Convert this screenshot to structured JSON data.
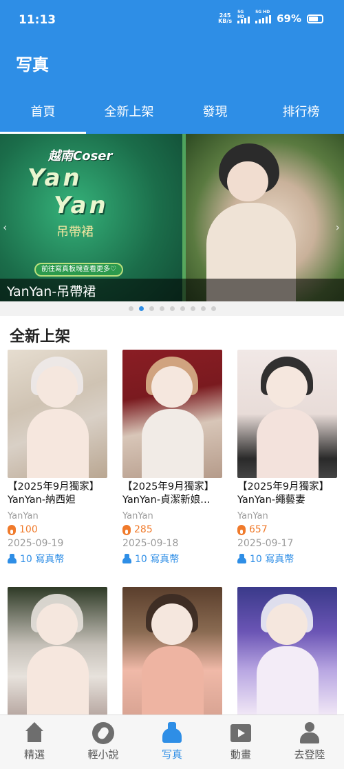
{
  "status_bar": {
    "time": "11:13",
    "net_speed": "245",
    "net_unit": "KB/s",
    "sig1_label": "5G HD",
    "sig2_label": "5G HD",
    "battery": "69%"
  },
  "header": {
    "title": "写真"
  },
  "tabs": [
    {
      "label": "首頁",
      "active": true
    },
    {
      "label": "全新上架",
      "active": false
    },
    {
      "label": "發現",
      "active": false
    },
    {
      "label": "排行榜",
      "active": false
    }
  ],
  "banner": {
    "promo_coser": "越南Coser",
    "promo_name_1": "Yan",
    "promo_name_2": "Yan",
    "promo_sub": "吊帶裙",
    "promo_cta": "前往寫真板塊查看更多♡",
    "caption": "YanYan-吊帶裙",
    "active_index": 1,
    "page_count": 9
  },
  "section": {
    "title": "全新上架",
    "items": [
      {
        "name": "【2025年9月獨家】YanYan-納西妲",
        "author": "YanYan",
        "heat": "100",
        "date": "2025-09-19",
        "price": "10 寫真幣"
      },
      {
        "name": "【2025年9月獨家】YanYan-貞潔新娘…",
        "author": "YanYan",
        "heat": "285",
        "date": "2025-09-18",
        "price": "10 寫真幣"
      },
      {
        "name": "【2025年9月獨家】YanYan-繩藝妻",
        "author": "YanYan",
        "heat": "657",
        "date": "2025-09-17",
        "price": "10 寫真幣"
      }
    ]
  },
  "bottom_nav": [
    {
      "label": "精選",
      "icon": "home-icon",
      "active": false
    },
    {
      "label": "輕小說",
      "icon": "compass-icon",
      "active": false
    },
    {
      "label": "写真",
      "icon": "dress-icon",
      "active": true
    },
    {
      "label": "動畫",
      "icon": "play-icon",
      "active": false
    },
    {
      "label": "去登陸",
      "icon": "user-icon",
      "active": false
    }
  ],
  "colors": {
    "accent": "#2e8ee6",
    "heat": "#f07a2b",
    "muted": "#9a9a9a"
  }
}
